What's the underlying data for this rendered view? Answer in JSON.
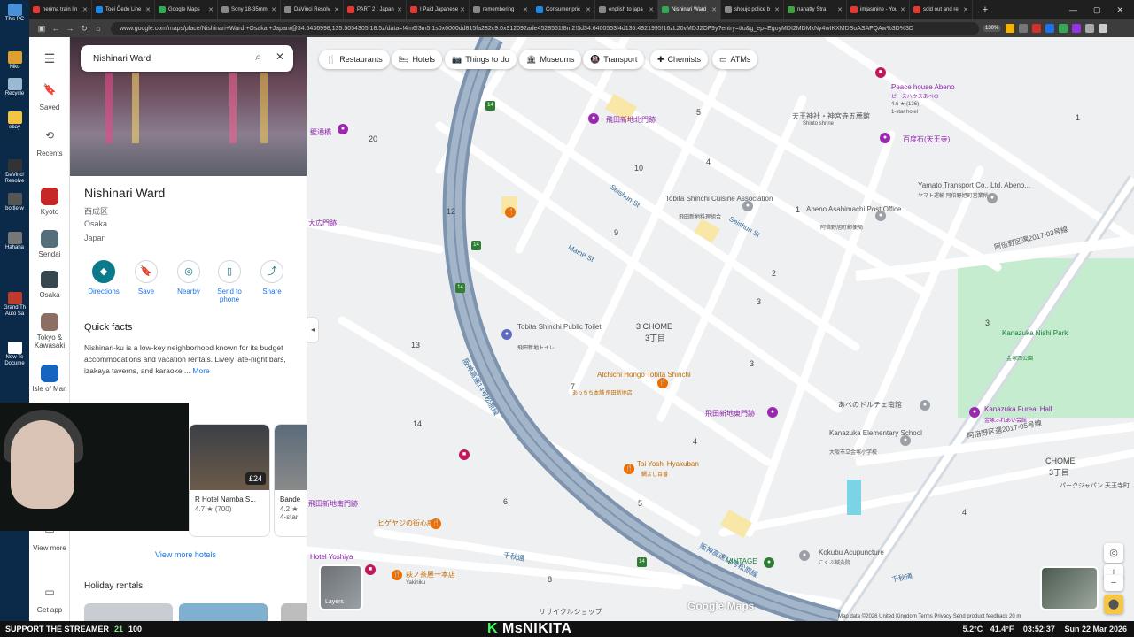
{
  "browser": {
    "tabs": [
      {
        "label": "nerima train lin",
        "color": "#e53935"
      },
      {
        "label": "Toei Ōedo Line",
        "color": "#1e88e5"
      },
      {
        "label": "Google Maps",
        "color": "#34a853"
      },
      {
        "label": "Sony 18-35mm",
        "color": "#888888"
      },
      {
        "label": "DaVinci Resolv",
        "color": "#888888"
      },
      {
        "label": "PART 2 : Japan",
        "color": "#e53935"
      },
      {
        "label": "I Paid Japanese",
        "color": "#e53935"
      },
      {
        "label": "remembering",
        "color": "#888888"
      },
      {
        "label": "Consumer pric",
        "color": "#1e88e5"
      },
      {
        "label": "english to japa",
        "color": "#888888"
      },
      {
        "label": "Nishinari Ward",
        "color": "#34a853",
        "active": true
      },
      {
        "label": "shoujo police b",
        "color": "#888888"
      },
      {
        "label": "nanatty Stra",
        "color": "#43a047"
      },
      {
        "label": "imjasmine - You",
        "color": "#e53935"
      },
      {
        "label": "sold out and re",
        "color": "#e53935"
      }
    ],
    "new_tab": "+",
    "url": "www.google.com/maps/place/Nishinari+Ward,+Osaka,+Japan/@34.6436998,135.5054305,18.5z/data=!4m6!3m5!1s0x6000dd815fa282c9:0x912092ade4528551!8m2!3d34.6400553!4d135.4921995!16zL20vMDJ2OF9y?entry=ttu&g_ep=EgoyMDI2MDMxNy4wIKXMDSoASAFQAw%3D%3D",
    "zoom": "130%"
  },
  "desktop": {
    "icons": [
      {
        "label": "This PC",
        "color": "#4a90d9"
      },
      {
        "label": "Niko",
        "color": "#e0a030"
      },
      {
        "label": "Recycle",
        "color": "#9bb8d3"
      },
      {
        "label": "ebay",
        "color": "#f5c542"
      },
      {
        "label": "DaVinci Resolve",
        "color": "#333333"
      },
      {
        "label": "bottle.w",
        "color": "#555555"
      },
      {
        "label": "Hahaha",
        "color": "#777777"
      },
      {
        "label": "Grand Th Auto Sa",
        "color": "#c0392b"
      },
      {
        "label": "New Te Docume",
        "color": "#ffffff"
      }
    ]
  },
  "rail": {
    "menu": "Menu",
    "items": [
      {
        "label": "Saved",
        "icon": "bookmark-icon"
      },
      {
        "label": "Recents",
        "icon": "history-icon"
      },
      {
        "label": "Kyoto",
        "color": "#c62828"
      },
      {
        "label": "Sendai",
        "color": "#546e7a"
      },
      {
        "label": "Osaka",
        "color": "#37474f"
      },
      {
        "label": "Tokyo & Kawasaki",
        "color": "#8d6e63"
      },
      {
        "label": "Isle of Man",
        "color": "#1565c0"
      },
      {
        "label": "View more"
      },
      {
        "label": "Get app"
      }
    ]
  },
  "panel": {
    "search_value": "Nishinari Ward",
    "title": "Nishinari Ward",
    "address": [
      "西成区",
      "Osaka",
      "Japan"
    ],
    "actions": [
      {
        "label": "Directions",
        "glyph": "◆"
      },
      {
        "label": "Save",
        "glyph": "🔖"
      },
      {
        "label": "Nearby",
        "glyph": "◎"
      },
      {
        "label": "Send to phone",
        "glyph": "▯"
      },
      {
        "label": "Share",
        "glyph": "⤴"
      }
    ],
    "quick_facts_title": "Quick facts",
    "quick_facts_text": "Nishinari-ku is a low-key neighborhood known for its budget accommodations and vacation rentals. Lively late-night bars, izakaya taverns, and karaoke ...",
    "quick_facts_more": "More",
    "hotels": [
      {
        "name": "R Hotel Namba S...",
        "rating": "4.7 ★ (700)",
        "price": "£24"
      },
      {
        "name": "Bande",
        "rating": "4.2 ★",
        "class": "4-star"
      }
    ],
    "view_more_hotels": "View more hotels",
    "holiday_rentals": "Holiday rentals"
  },
  "map": {
    "chips": [
      {
        "label": "Restaurants",
        "icon": "🍴"
      },
      {
        "label": "Hotels",
        "icon": "🛏"
      },
      {
        "label": "Things to do",
        "icon": "📷"
      },
      {
        "label": "Museums",
        "icon": "🏛"
      },
      {
        "label": "Transport",
        "icon": "🚇"
      },
      {
        "label": "Chemists",
        "icon": "✚"
      },
      {
        "label": "ATMs",
        "icon": "▭"
      }
    ],
    "labels": {
      "peace_house": "Peace house Abeno",
      "peace_house_jp": "ピースハウスあべの",
      "peace_rating": "4.6 ★ (126)",
      "peace_star": "1-star hotel",
      "tobita_north": "飛田新地北門跡",
      "tenmangu": "天王神社・神宮寺五薦館",
      "shinto": "Shinto shrine",
      "hyakudo": "百度石(天王寺)",
      "yamato": "Yamato Transport Co., Ltd. Abeno...",
      "yamato_jp": "ヤマト運輸 阿倍野旭町営業所",
      "tobita_cuisine": "Tobita Shinchi Cuisine Association",
      "tobita_cuisine_jp": "飛田新地料理組合",
      "abeno_post": "Abeno Asahimachi Post Office",
      "abeno_post_jp": "阿倍野旭町郵便局",
      "hanshin_line": "阪神高速14号松原線",
      "abeno_route": "阿倍野区選2017-03号線",
      "seishun_st": "Seishun St",
      "maine_st": "Maine St",
      "three_chome": "3 CHOME",
      "three_chome_jp": "3丁目",
      "tobita_toilet": "Tobita Shinchi Public Toilet",
      "tobita_toilet_jp": "飛田新地トイレ",
      "kanazuka_park": "Kanazuka Nishi Park",
      "kanazuka_park_jp": "金塚西公園",
      "atchichi": "Atchichi Hongo Tobita Shinchi",
      "atchichi_jp": "あっちち本舗 飛田新地店",
      "tobita_gate": "飛田新地東門跡",
      "abeno_dolce": "あべのドルチェ南館",
      "kanazuka_hall": "Kanazuka Fureai Hall",
      "kanazuka_hall_jp": "金塚ふれあい会館",
      "kanazuka_school": "Kanazuka Elementary School",
      "kanazuka_school_jp": "大阪市立金塚小学校",
      "tai_yoshi": "Tai Yoshi Hyakuban",
      "tai_yoshi_jp": "鯛よし百番",
      "kanazuka_kokuhin": "Kokubu Acupuncture",
      "kokubu_jp": "こくぶ鍼灸院",
      "vintage": "VINTAGE",
      "higeyaji": "ヒゲヤジの街心庵",
      "tobita_south": "飛田新地南門跡",
      "hotel_yoshiya": "Hotel Yoshiya",
      "hagi": "萩ノ茶屋一本店",
      "sembon": "千秋通",
      "sembon2": "千秋通",
      "recycle_shop": "リサイクルショップ",
      "chome_right": "CHOME",
      "chome_right_jp": "3丁目",
      "park_japan": "パークジャパン 天王寺町",
      "eastern_label": "阿倍野区選2017-05号線",
      "kabeshita": "壁通橋",
      "taishi_minami": "大広門跡",
      "yakiniku": "Yakiniku"
    },
    "block_numbers": [
      "20",
      "12",
      "13",
      "14",
      "6",
      "7",
      "9",
      "10",
      "5",
      "5",
      "4",
      "3",
      "2",
      "1",
      "1",
      "3",
      "4",
      "8",
      "3",
      "4"
    ],
    "route_shield": "14",
    "layers": "Layers",
    "google_maps": "Google Maps",
    "footer": "Map data ©2026   United Kingdom   Terms   Privacy   Send product feedback   20 m"
  },
  "webcam": {
    "description_hidden": ""
  },
  "taskbar": {
    "support": "SUPPORT THE STREAMER",
    "count1": "21",
    "count2": "100",
    "streamer_prefix": "K",
    "streamer_name": "MsNIKITA",
    "temp": "5.2°C",
    "temp_f": "41.4°F",
    "time": "03:52:37",
    "date": "Sun 22 Mar 2026"
  }
}
